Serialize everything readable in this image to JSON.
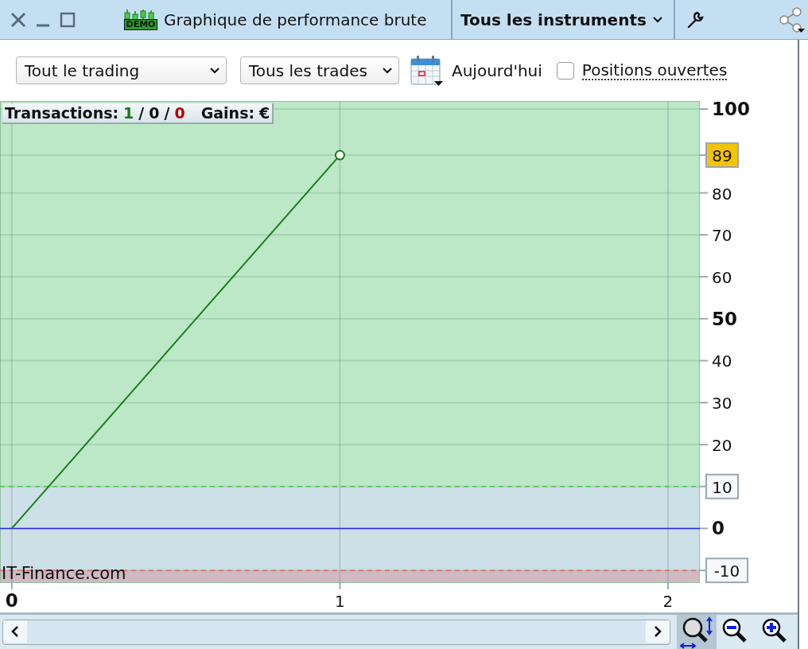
{
  "window": {
    "badge": "DEMO",
    "title": "Graphique de performance brute",
    "instrument_menu": "Tous les instruments"
  },
  "toolbar": {
    "scope_select": "Tout le trading",
    "trades_select": "Tous les trades",
    "date_button": "Aujourd'hui",
    "open_positions": {
      "label": "Positions ouvertes",
      "checked": false
    }
  },
  "chart": {
    "summary": [
      {
        "text": "Transactions:",
        "kind": "label"
      },
      {
        "text": "1",
        "kind": "win"
      },
      {
        "text": "/",
        "kind": "sep"
      },
      {
        "text": "0",
        "kind": "neutral"
      },
      {
        "text": "/",
        "kind": "sep"
      },
      {
        "text": "0",
        "kind": "loss"
      },
      {
        "text": "Gains:",
        "kind": "label"
      },
      {
        "text": "€",
        "kind": "value"
      }
    ],
    "broker_label": "IT-Finance.com",
    "chart_data": {
      "type": "line",
      "x": [
        0,
        1
      ],
      "series": [
        {
          "color": "#1a7f1a",
          "values": [
            0,
            89
          ]
        }
      ],
      "xlim": [
        -0.036,
        2.097
      ],
      "ylim": [
        -13,
        101.9
      ],
      "xticks": [
        0,
        1,
        2
      ],
      "yticks": [
        0,
        20,
        30,
        40,
        50,
        60,
        70,
        80,
        100
      ],
      "grid": true,
      "bands": [
        {
          "axis": "y",
          "from": 10,
          "to": 101.9,
          "color": "#bce8c8"
        },
        {
          "axis": "y",
          "from": -10,
          "to": 10,
          "color": "#cddfe7"
        },
        {
          "axis": "y",
          "from": -13,
          "to": -10,
          "color": "#d0b9c1"
        }
      ],
      "ref_lines": [
        {
          "axis": "y",
          "value": 10,
          "color": "#4ccc4c",
          "label": "10"
        },
        {
          "axis": "y",
          "value": -10,
          "color": "#e06a6a",
          "label": "-10"
        },
        {
          "axis": "y",
          "value": 0,
          "color": "#2a2ad8"
        }
      ],
      "annotations": [
        "89"
      ]
    }
  },
  "zoom_tools": [
    {
      "kind": "auto",
      "selected": true
    },
    {
      "kind": "zoom-out",
      "selected": false
    },
    {
      "kind": "zoom-in",
      "selected": false
    }
  ]
}
